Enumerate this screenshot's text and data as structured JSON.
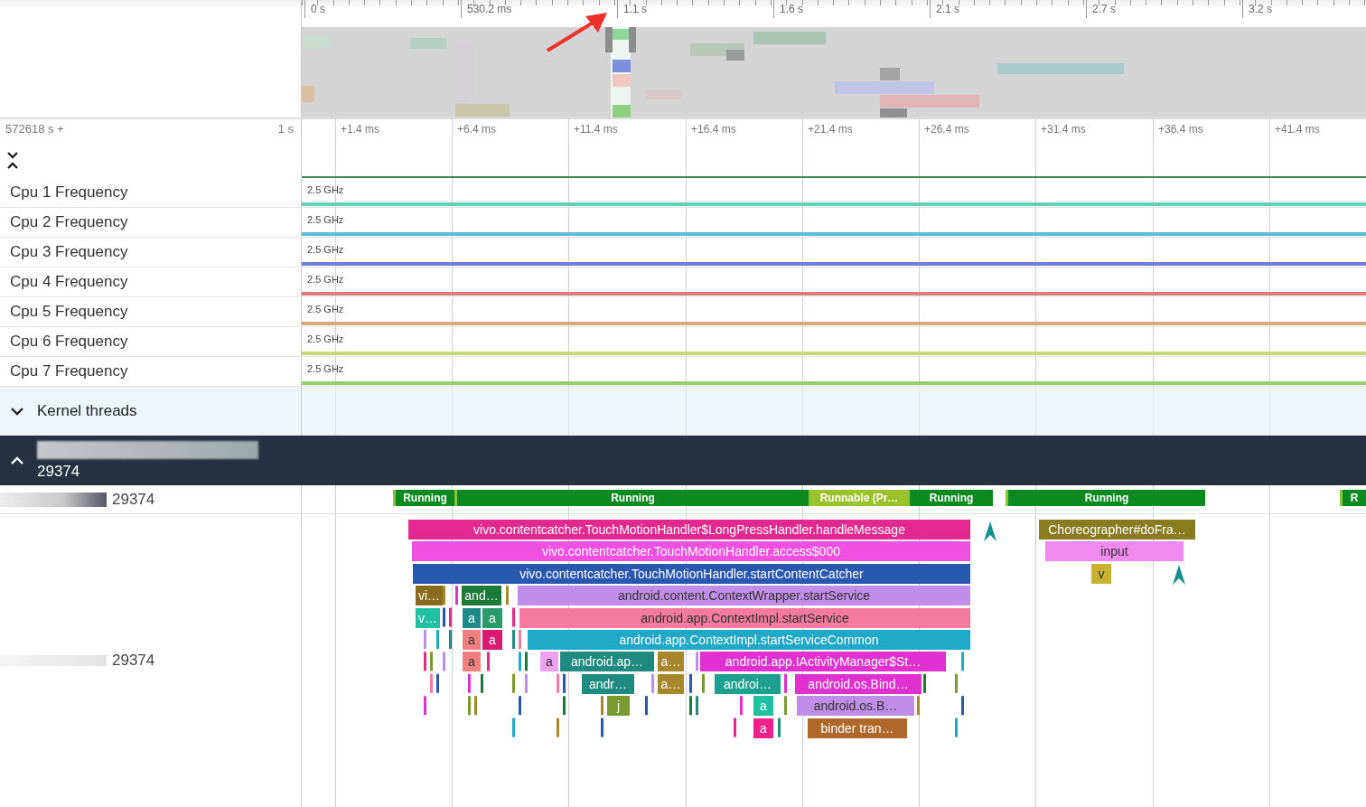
{
  "overview": {
    "ticks": [
      "0 s",
      "530.2 ms",
      "1.1 s",
      "1.6 s",
      "2.1 s",
      "2.7 s",
      "3.2 s"
    ]
  },
  "ruler": {
    "offset": "572618 s +",
    "scale": "1 s",
    "ticks": [
      "+1.4 ms",
      "+6.4 ms",
      "+11.4 ms",
      "+16.4 ms",
      "+21.4 ms",
      "+26.4 ms",
      "+31.4 ms",
      "+36.4 ms",
      "+41.4 ms"
    ]
  },
  "tracks": [
    {
      "name": "Cpu 1 Frequency",
      "reading": "2.5 GHz",
      "color": "#5fd3b3"
    },
    {
      "name": "Cpu 2 Frequency",
      "reading": "2.5 GHz",
      "color": "#5bbdd6"
    },
    {
      "name": "Cpu 3 Frequency",
      "reading": "2.5 GHz",
      "color": "#6f7fd8"
    },
    {
      "name": "Cpu 4 Frequency",
      "reading": "2.5 GHz",
      "color": "#e07a7a"
    },
    {
      "name": "Cpu 5 Frequency",
      "reading": "2.5 GHz",
      "color": "#d9a878"
    },
    {
      "name": "Cpu 6 Frequency",
      "reading": "2.5 GHz",
      "color": "#c8d97a"
    },
    {
      "name": "Cpu 7 Frequency",
      "reading": "2.5 GHz",
      "color": "#96cf6e"
    }
  ],
  "kernel_threads": {
    "label": "Kernel threads",
    "expanded": false
  },
  "process": {
    "pid": "29374",
    "expanded": true
  },
  "thread_state": {
    "label": "29374",
    "segments": [
      {
        "label": "Running",
        "kind": "running"
      },
      {
        "label": "Running",
        "kind": "running"
      },
      {
        "label": "Runnable (Pr…",
        "kind": "runnable"
      },
      {
        "label": "Running",
        "kind": "running"
      },
      {
        "label": "Running",
        "kind": "running"
      },
      {
        "label": "R",
        "kind": "running"
      }
    ]
  },
  "slices_track": {
    "label": "29374",
    "slices": [
      {
        "name": "vivo.contentcatcher.TouchMotionHandler$LongPressHandler.handleMessage",
        "color": "#e5288f"
      },
      {
        "name": "vivo.contentcatcher.TouchMotionHandler.access$000",
        "color": "#f050e0"
      },
      {
        "name": "vivo.contentcatcher.TouchMotionHandler.startContentCatcher",
        "color": "#2858b0"
      },
      {
        "name": "vi…",
        "color": "#8a6a1c"
      },
      {
        "name": "and…",
        "color": "#1e7a3a"
      },
      {
        "name": "android.content.ContextWrapper.startService",
        "color": "#c08ee8"
      },
      {
        "name": "v…",
        "color": "#20c0a0"
      },
      {
        "name": "a",
        "color": "#1e8a8a"
      },
      {
        "name": "a",
        "color": "#2a9a6a"
      },
      {
        "name": "android.app.ContextImpl.startService",
        "color": "#f47aa0"
      },
      {
        "name": "a",
        "color": "#f08080"
      },
      {
        "name": "a",
        "color": "#d81b70"
      },
      {
        "name": "android.app.ContextImpl.startServiceCommon",
        "color": "#20a8c8"
      },
      {
        "name": "a",
        "color": "#f08080"
      },
      {
        "name": "a",
        "color": "#f0a0f0"
      },
      {
        "name": "android.ap…",
        "color": "#1e8a80"
      },
      {
        "name": "a…",
        "color": "#a8862a"
      },
      {
        "name": "android.app.IActivityManager$St…",
        "color": "#e030d0"
      },
      {
        "name": "andr…",
        "color": "#1e8a80"
      },
      {
        "name": "a…",
        "color": "#a8862a"
      },
      {
        "name": "androi…",
        "color": "#1ea090"
      },
      {
        "name": "android.os.Bind…",
        "color": "#e030d0"
      },
      {
        "name": "j",
        "color": "#7a9a30"
      },
      {
        "name": "a",
        "color": "#20c0a0"
      },
      {
        "name": "android.os.B…",
        "color": "#c08ee8"
      },
      {
        "name": "a",
        "color": "#f0208a"
      },
      {
        "name": "binder tran…",
        "color": "#b0682a"
      },
      {
        "name": "Choreographer#doFra…",
        "color": "#8a7a20"
      },
      {
        "name": "input",
        "color": "#f08af0"
      },
      {
        "name": "v",
        "color": "#c8b030"
      }
    ]
  }
}
